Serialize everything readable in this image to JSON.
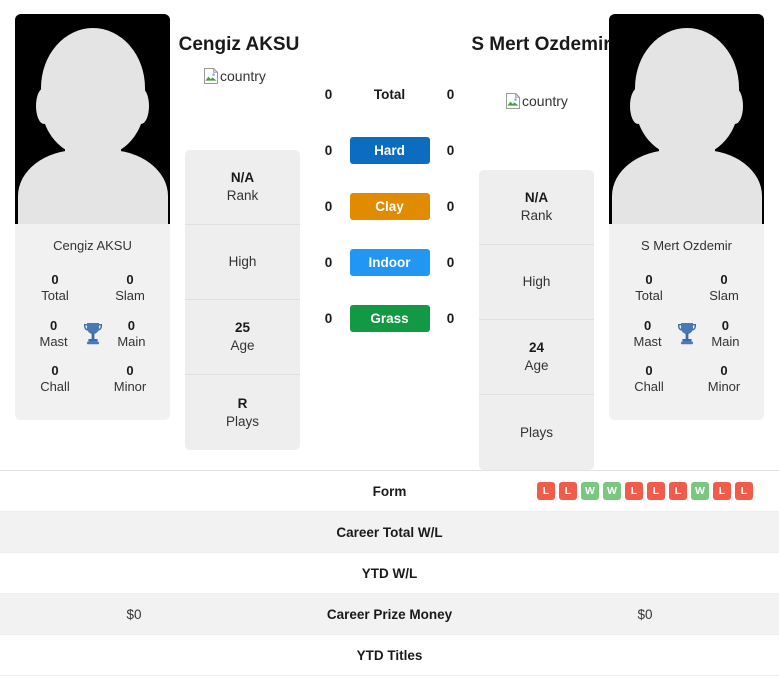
{
  "players": [
    {
      "name": "Cengiz AKSU",
      "photo_caption": "Cengiz AKSU",
      "country_alt": "country",
      "titles": [
        {
          "value": "0",
          "label": "Total"
        },
        {
          "value": "0",
          "label": "Slam"
        },
        {
          "value": "0",
          "label": "Mast"
        },
        {
          "value": "0",
          "label": "Main"
        },
        {
          "value": "0",
          "label": "Chall"
        },
        {
          "value": "0",
          "label": "Minor"
        }
      ],
      "info": [
        {
          "value": "N/A",
          "label": "Rank"
        },
        {
          "value": "",
          "label": "High"
        },
        {
          "value": "25",
          "label": "Age"
        },
        {
          "value": "R",
          "label": "Plays"
        }
      ],
      "surface_counts": [
        "0",
        "0",
        "0",
        "0",
        "0"
      ],
      "prize_money": "$0"
    },
    {
      "name": "S Mert Ozdemir",
      "photo_caption": "S Mert Ozdemir",
      "country_alt": "country",
      "titles": [
        {
          "value": "0",
          "label": "Total"
        },
        {
          "value": "0",
          "label": "Slam"
        },
        {
          "value": "0",
          "label": "Mast"
        },
        {
          "value": "0",
          "label": "Main"
        },
        {
          "value": "0",
          "label": "Chall"
        },
        {
          "value": "0",
          "label": "Minor"
        }
      ],
      "info": [
        {
          "value": "N/A",
          "label": "Rank"
        },
        {
          "value": "",
          "label": "High"
        },
        {
          "value": "24",
          "label": "Age"
        },
        {
          "value": "",
          "label": "Plays"
        }
      ],
      "surface_counts": [
        "0",
        "0",
        "0",
        "0",
        "0"
      ],
      "prize_money": "$0"
    }
  ],
  "surfaces": [
    {
      "label": "Total",
      "color": "transparent",
      "plain": true
    },
    {
      "label": "Hard",
      "color": "#0c6cc0",
      "plain": false
    },
    {
      "label": "Clay",
      "color": "#e08b00",
      "plain": false
    },
    {
      "label": "Indoor",
      "color": "#2196f3",
      "plain": false
    },
    {
      "label": "Grass",
      "color": "#119944",
      "plain": false
    }
  ],
  "table": {
    "rows": [
      {
        "label": "Form",
        "left": "",
        "right": ""
      },
      {
        "label": "Career Total W/L",
        "left": "",
        "right": ""
      },
      {
        "label": "YTD W/L",
        "left": "",
        "right": ""
      },
      {
        "label": "Career Prize Money",
        "left": "$0",
        "right": "$0"
      },
      {
        "label": "YTD Titles",
        "left": "",
        "right": ""
      }
    ],
    "form": {
      "results": [
        "L",
        "L",
        "W",
        "W",
        "L",
        "L",
        "L",
        "W",
        "L",
        "L"
      ],
      "win_color": "#7ac77f",
      "loss_color": "#f15b4a"
    }
  },
  "icons": {
    "trophy": "trophy-icon",
    "broken_image": "broken-image-icon"
  },
  "colors": {
    "card_bg": "#f1f1f1",
    "info_bg": "#eeeeee",
    "photo_bg": "#000000",
    "silhouette": "#e4e4e4",
    "row_alt": "#f2f2f2"
  }
}
